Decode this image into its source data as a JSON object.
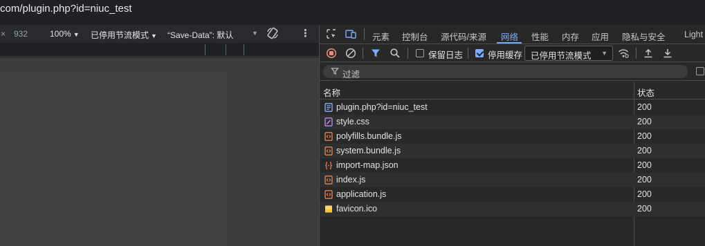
{
  "address_bar": {
    "url": "com/plugin.php?id=niuc_test"
  },
  "viewport_toolbar": {
    "close_glyph": "×",
    "height_value": "932",
    "zoom": "100%",
    "throttling": "已停用节流模式",
    "save_data": "“Save-Data”: 默认",
    "more_glyph": "⋮"
  },
  "devtools": {
    "tabs": [
      {
        "label": "元素"
      },
      {
        "label": "控制台"
      },
      {
        "label": "源代码/来源"
      },
      {
        "label": "网络",
        "active": true
      },
      {
        "label": "性能"
      },
      {
        "label": "内存"
      },
      {
        "label": "应用"
      },
      {
        "label": "隐私与安全"
      },
      {
        "label": "Light"
      }
    ],
    "network_toolbar": {
      "preserve_log": {
        "label": "保留日志",
        "checked": false
      },
      "disable_cache": {
        "label": "停用缓存",
        "checked": true
      },
      "throttling_select": "已停用节流模式"
    },
    "filter": {
      "placeholder": "过滤"
    },
    "table": {
      "columns": [
        "名称",
        "状态"
      ],
      "rows": [
        {
          "name": "plugin.php?id=niuc_test",
          "status": "200",
          "type": "document"
        },
        {
          "name": "style.css",
          "status": "200",
          "type": "stylesheet"
        },
        {
          "name": "polyfills.bundle.js",
          "status": "200",
          "type": "script"
        },
        {
          "name": "system.bundle.js",
          "status": "200",
          "type": "script"
        },
        {
          "name": "import-map.json",
          "status": "200",
          "type": "json"
        },
        {
          "name": "index.js",
          "status": "200",
          "type": "script"
        },
        {
          "name": "application.js",
          "status": "200",
          "type": "script"
        },
        {
          "name": "favicon.ico",
          "status": "200",
          "type": "image"
        }
      ]
    }
  },
  "colors": {
    "accent": "#7cacf8",
    "record_red": "#f28b82",
    "doc_icon": "#8ab4f8",
    "css_icon": "#c58af9",
    "script_icon": "#e8844a",
    "image_icon": "#fdd663"
  }
}
